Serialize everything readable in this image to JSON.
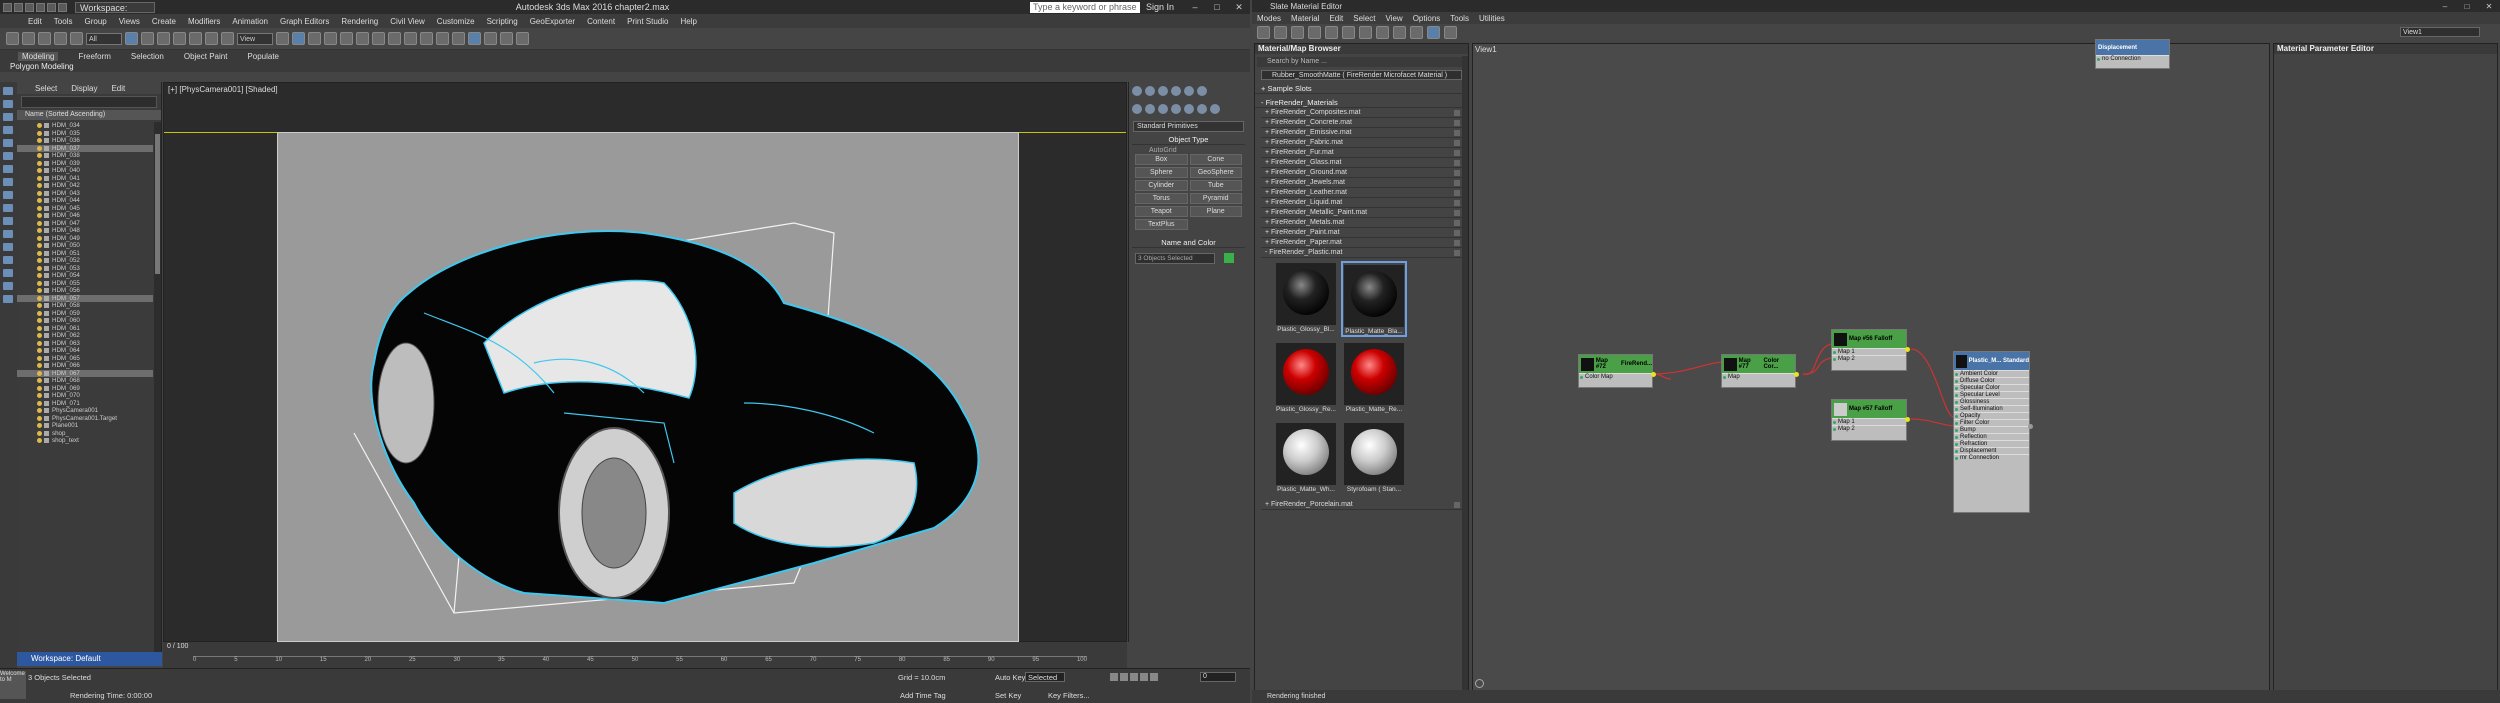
{
  "max": {
    "workspace_label": "Workspace: Default",
    "title": "Autodesk 3ds Max 2016    chapter2.max",
    "search_placeholder": "Type a keyword or phrase",
    "sign_in": "Sign In",
    "menu": [
      "Edit",
      "Tools",
      "Group",
      "Views",
      "Create",
      "Modifiers",
      "Animation",
      "Graph Editors",
      "Rendering",
      "Civil View",
      "Customize",
      "Scripting",
      "GeoExporter",
      "Content",
      "Print Studio",
      "Help"
    ],
    "toolbar_selection": "All",
    "toolbar_view": "View",
    "ribbon_tabs": [
      "Modeling",
      "Freeform",
      "Selection",
      "Object Paint",
      "Populate"
    ],
    "ribbon_sub": "Polygon Modeling",
    "explorer_tabs": [
      "Select",
      "Display",
      "Edit"
    ],
    "explorer_header": "Name (Sorted Ascending)",
    "explorer_rows": [
      "HDM_034",
      "HDM_035",
      "HDM_036",
      "HDM_037",
      "HDM_038",
      "HDM_039",
      "HDM_040",
      "HDM_041",
      "HDM_042",
      "HDM_043",
      "HDM_044",
      "HDM_045",
      "HDM_046",
      "HDM_047",
      "HDM_048",
      "HDM_049",
      "HDM_050",
      "HDM_051",
      "HDM_052",
      "HDM_053",
      "HDM_054",
      "HDM_055",
      "HDM_056",
      "HDM_057",
      "HDM_058",
      "HDM_059",
      "HDM_060",
      "HDM_061",
      "HDM_062",
      "HDM_063",
      "HDM_064",
      "HDM_065",
      "HDM_066",
      "HDM_067",
      "HDM_068",
      "HDM_069",
      "HDM_070",
      "HDM_071",
      "PhysCamera001",
      "PhysCamera001.Target",
      "Plane001",
      "shop_",
      "shop_text"
    ],
    "explorer_selected": [
      3,
      23,
      33
    ],
    "workspace_bottom": "Workspace: Default",
    "viewport_label": "[+] [PhysCamera001] [Shaded]",
    "cmd_dropdown": "Standard Primitives",
    "object_type": "Object Type",
    "autogrid": "AutoGrid",
    "primitives": [
      "Box",
      "Cone",
      "Sphere",
      "GeoSphere",
      "Cylinder",
      "Tube",
      "Torus",
      "Pyramid",
      "Teapot",
      "Plane",
      "TextPlus"
    ],
    "name_and_color": "Name and Color",
    "name_field": "3 Objects Selected",
    "time_slider": "0 / 100",
    "ticks": [
      "0",
      "5",
      "10",
      "15",
      "20",
      "25",
      "30",
      "35",
      "40",
      "45",
      "50",
      "55",
      "60",
      "65",
      "70",
      "75",
      "80",
      "85",
      "90",
      "95",
      "100"
    ],
    "status_selected": "3 Objects Selected",
    "status_render": "Rendering Time: 0:00:00",
    "grid": "Grid = 10.0cm",
    "auto_key": "Auto Key",
    "selected_dd": "Selected",
    "set_key": "Set Key",
    "key_filters": "Key Filters...",
    "add_time_tag": "Add Time Tag",
    "frame": "0",
    "maxscript": "Welcome to M"
  },
  "sme": {
    "title": "Slate Material Editor",
    "menu": [
      "Modes",
      "Material",
      "Edit",
      "Select",
      "View",
      "Options",
      "Tools",
      "Utilities"
    ],
    "view_dropdown": "View1",
    "browser_title": "Material/Map Browser",
    "search_placeholder": "Search by Name ...",
    "rubber_item": "Rubber_SmoothMatte ( FireRender Microfacet Material )",
    "sample_slots": "+ Sample Slots",
    "firerender_header": "- FireRender_Materials",
    "materials": [
      "+ FireRender_Composites.mat",
      "+ FireRender_Concrete.mat",
      "+ FireRender_Emissive.mat",
      "+ FireRender_Fabric.mat",
      "+ FireRender_Fur.mat",
      "+ FireRender_Glass.mat",
      "+ FireRender_Ground.mat",
      "+ FireRender_Jewels.mat",
      "+ FireRender_Leather.mat",
      "+ FireRender_Liquid.mat",
      "+ FireRender_Metallic_Paint.mat",
      "+ FireRender_Metals.mat",
      "+ FireRender_Paint.mat",
      "+ FireRender_Paper.mat",
      "- FireRender_Plastic.mat"
    ],
    "swatches": [
      {
        "label": "Plastic_Glossy_Bl...",
        "ball": "black"
      },
      {
        "label": "Plastic_Matte_Bla...",
        "ball": "black"
      },
      {
        "label": "Plastic_Glossy_Re...",
        "ball": "red"
      },
      {
        "label": "Plastic_Matte_Re...",
        "ball": "red"
      },
      {
        "label": "Plastic_Matte_Wh...",
        "ball": "white"
      },
      {
        "label": "Styrofoam ( Stan...",
        "ball": "white"
      }
    ],
    "porcelain": "+ FireRender_Porcelain.mat",
    "view_tab": "View1",
    "params_title": "Material Parameter Editor",
    "status": "Rendering finished",
    "nodes": {
      "displacement": {
        "title": "Displacement",
        "slot": "no Connection"
      },
      "map72": {
        "title": "Map #72",
        "sub": "FireRend...",
        "slot": "Color Map"
      },
      "map77": {
        "title": "Map #77",
        "sub": "Color Cor...",
        "slot": "Map"
      },
      "map56": {
        "title": "Map #56",
        "sub": "Falloff",
        "slots": [
          "Map 1",
          "Map 2"
        ]
      },
      "map57": {
        "title": "Map #57",
        "sub": "Falloff",
        "slots": [
          "Map 1",
          "Map 2"
        ]
      },
      "plastic": {
        "title": "Plastic_M...",
        "sub": "Standard",
        "slots": [
          "Ambient Color",
          "Diffuse Color",
          "Specular Color",
          "Specular Level",
          "Glossiness",
          "Self-Illumination",
          "Opacity",
          "Filter Color",
          "Bump",
          "Reflection",
          "Refraction",
          "Displacement",
          "mr Connection"
        ]
      }
    }
  },
  "colors": {
    "accent": "#4a74a8",
    "node_green": "#4aa046",
    "wire": "#cc3333",
    "selection_yellow": "#c8c600"
  }
}
